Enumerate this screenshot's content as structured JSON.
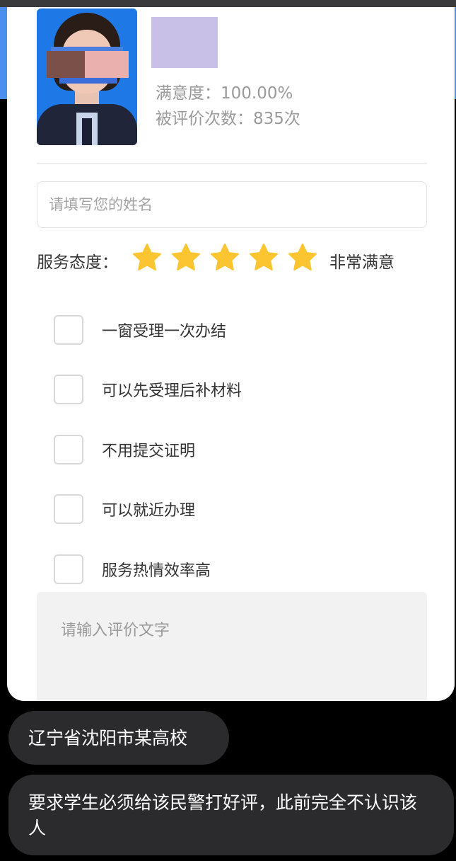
{
  "profile": {
    "satisfaction": "满意度：100.00%",
    "review_count": "被评价次数：835次"
  },
  "form": {
    "name_placeholder": "请填写您的姓名",
    "attitude_label": "服务态度：",
    "rating": 5,
    "rating_max": 5,
    "star_color": "#fbc531",
    "rating_text": "非常满意",
    "options": [
      "一窗受理一次办结",
      "可以先受理后补材料",
      "不用提交证明",
      "可以就近办理",
      "服务热情效率高"
    ],
    "comment_placeholder": "请输入评价文字"
  },
  "captions": [
    "辽宁省沈阳市某高校",
    "要求学生必须给该民警打好评，此前完全不认识该人"
  ]
}
